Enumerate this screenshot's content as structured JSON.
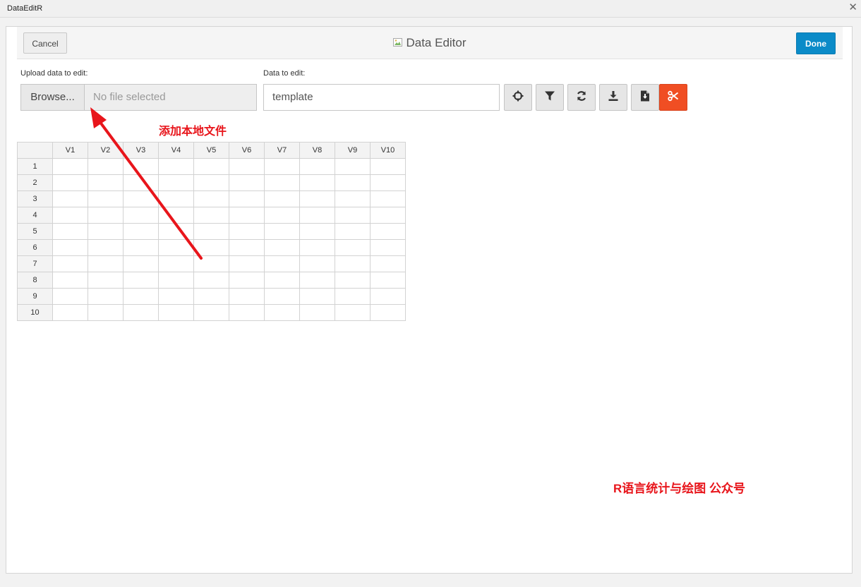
{
  "window": {
    "title": "DataEditR",
    "close_glyph": "✕"
  },
  "header": {
    "cancel_label": "Cancel",
    "title": "Data Editor",
    "done_label": "Done"
  },
  "upload": {
    "label": "Upload data to edit:",
    "browse_label": "Browse...",
    "file_placeholder": "No file selected"
  },
  "data_select": {
    "label": "Data to edit:",
    "value": "template"
  },
  "toolbar": {
    "icons": [
      "crosshairs-icon",
      "filter-icon",
      "sync-icon",
      "download-icon",
      "file-download-icon",
      "cut-icon"
    ],
    "cut_color": "#f04e23"
  },
  "annotations": {
    "arrow_label": "添加本地文件",
    "watermark": "R语言统计与绘图 公众号",
    "color": "#e8151b"
  },
  "table": {
    "columns": [
      "V1",
      "V2",
      "V3",
      "V4",
      "V5",
      "V6",
      "V7",
      "V8",
      "V9",
      "V10"
    ],
    "rows": [
      "1",
      "2",
      "3",
      "4",
      "5",
      "6",
      "7",
      "8",
      "9",
      "10"
    ]
  },
  "colors": {
    "done_button": "#0b8bc8",
    "cut_button": "#f04e23"
  }
}
